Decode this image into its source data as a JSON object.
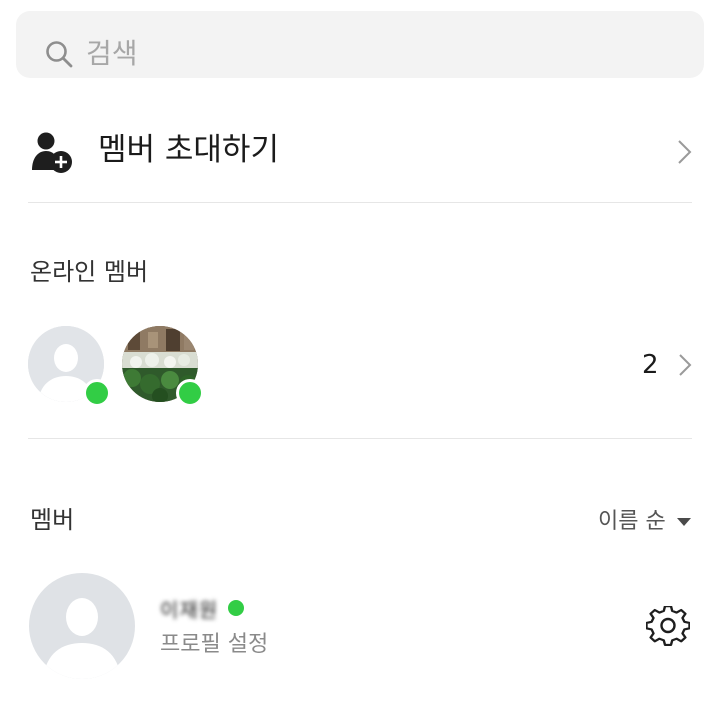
{
  "search": {
    "placeholder": "검색",
    "icon": "search-icon"
  },
  "invite": {
    "label": "멤버 초대하기",
    "icon": "add-person-icon"
  },
  "online": {
    "title": "온라인 멤버",
    "count": "2",
    "status_color": "#32cd45",
    "avatars": [
      "default-avatar",
      "photo-avatar"
    ]
  },
  "members": {
    "title": "멤버",
    "sort_label": "이름 순",
    "list": [
      {
        "name": "이재원",
        "subtitle": "프로필 설정",
        "status": "online"
      }
    ]
  },
  "colors": {
    "online_green": "#32cd45",
    "search_bg": "#f3f3f3",
    "divider": "#e6e6e6",
    "avatar_bg": "#dfe2e6"
  }
}
